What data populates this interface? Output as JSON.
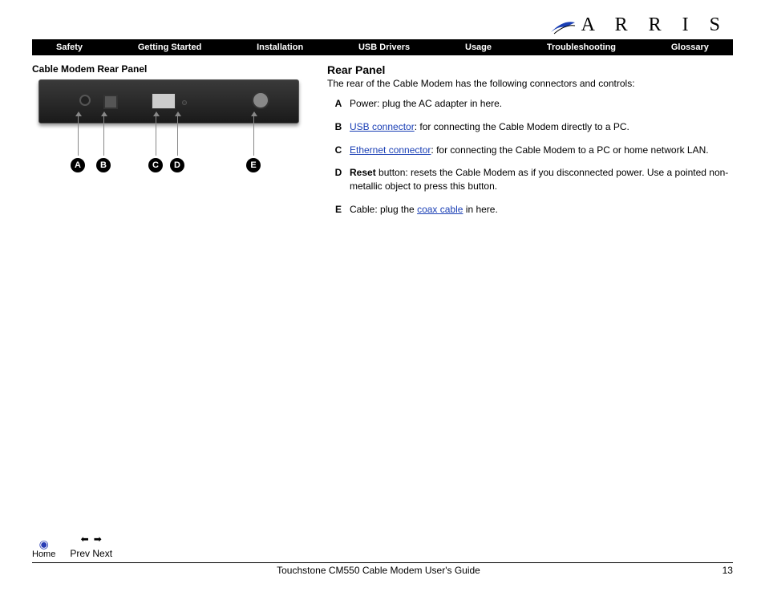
{
  "brand": "A R R I S",
  "nav": [
    "Safety",
    "Getting Started",
    "Installation",
    "USB Drivers",
    "Usage",
    "Troubleshooting",
    "Glossary"
  ],
  "left_heading": "Cable Modem Rear Panel",
  "callouts": [
    "A",
    "B",
    "C",
    "D",
    "E"
  ],
  "right_heading": "Rear Panel",
  "intro": "The rear of the Cable Modem has the following connectors and controls:",
  "items": {
    "A": {
      "pre": "Power: plug the AC adapter in here."
    },
    "B": {
      "link": "USB connector",
      "post": ": for connecting the Cable Modem directly to a PC."
    },
    "C": {
      "link": "Ethernet connector",
      "post": ": for connecting the Cable Modem to a PC or home network LAN."
    },
    "D": {
      "bold": "Reset",
      "post": " button: resets the Cable Modem as if you disconnected power. Use a pointed non-metallic object to press this button."
    },
    "E": {
      "pre": "Cable: plug the ",
      "link": "coax cable",
      "post": " in here."
    }
  },
  "footer": {
    "home": "Home",
    "prev": "Prev",
    "next": "Next",
    "title": "Touchstone CM550 Cable Modem User's Guide",
    "page": "13"
  }
}
